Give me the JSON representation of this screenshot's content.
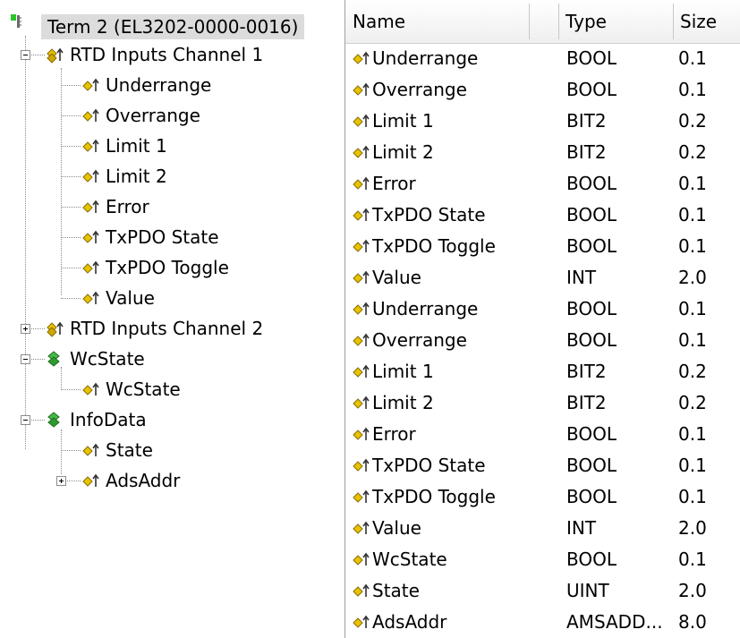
{
  "tree": {
    "root": {
      "label": "Term 2 (EL3202-0000-0016)"
    },
    "nodes": [
      {
        "label": "RTD Inputs Channel 1",
        "icon": "var-group-icon"
      },
      {
        "label": "Underrange",
        "icon": "input-var-icon"
      },
      {
        "label": "Overrange",
        "icon": "input-var-icon"
      },
      {
        "label": "Limit 1",
        "icon": "input-var-icon"
      },
      {
        "label": "Limit 2",
        "icon": "input-var-icon"
      },
      {
        "label": "Error",
        "icon": "input-var-icon"
      },
      {
        "label": "TxPDO State",
        "icon": "input-var-icon"
      },
      {
        "label": "TxPDO Toggle",
        "icon": "input-var-icon"
      },
      {
        "label": "Value",
        "icon": "input-var-icon"
      },
      {
        "label": "RTD Inputs Channel 2",
        "icon": "var-group-icon"
      },
      {
        "label": "WcState",
        "icon": "green-group-icon"
      },
      {
        "label": "WcState",
        "icon": "input-var-icon"
      },
      {
        "label": "InfoData",
        "icon": "green-group-icon"
      },
      {
        "label": "State",
        "icon": "input-var-icon"
      },
      {
        "label": "AdsAddr",
        "icon": "input-var-icon"
      }
    ]
  },
  "list": {
    "columns": [
      "Name",
      "Type",
      "Size"
    ],
    "rows": [
      {
        "name": "Underrange",
        "type": "BOOL",
        "size": "0.1"
      },
      {
        "name": "Overrange",
        "type": "BOOL",
        "size": "0.1"
      },
      {
        "name": "Limit 1",
        "type": "BIT2",
        "size": "0.2"
      },
      {
        "name": "Limit 2",
        "type": "BIT2",
        "size": "0.2"
      },
      {
        "name": "Error",
        "type": "BOOL",
        "size": "0.1"
      },
      {
        "name": "TxPDO State",
        "type": "BOOL",
        "size": "0.1"
      },
      {
        "name": "TxPDO Toggle",
        "type": "BOOL",
        "size": "0.1"
      },
      {
        "name": "Value",
        "type": "INT",
        "size": "2.0"
      },
      {
        "name": "Underrange",
        "type": "BOOL",
        "size": "0.1"
      },
      {
        "name": "Overrange",
        "type": "BOOL",
        "size": "0.1"
      },
      {
        "name": "Limit 1",
        "type": "BIT2",
        "size": "0.2"
      },
      {
        "name": "Limit 2",
        "type": "BIT2",
        "size": "0.2"
      },
      {
        "name": "Error",
        "type": "BOOL",
        "size": "0.1"
      },
      {
        "name": "TxPDO State",
        "type": "BOOL",
        "size": "0.1"
      },
      {
        "name": "TxPDO Toggle",
        "type": "BOOL",
        "size": "0.1"
      },
      {
        "name": "Value",
        "type": "INT",
        "size": "2.0"
      },
      {
        "name": "WcState",
        "type": "BOOL",
        "size": "0.1"
      },
      {
        "name": "State",
        "type": "UINT",
        "size": "2.0"
      },
      {
        "name": "AdsAddr",
        "type": "AMSADD...",
        "size": "8.0"
      }
    ]
  },
  "colors": {
    "selection_bg": "#dcdcdc",
    "var_icon_yellow": "#e8c400",
    "group_icon_green": "#2e9b2e",
    "tree_lines": "#8a8a8a"
  }
}
